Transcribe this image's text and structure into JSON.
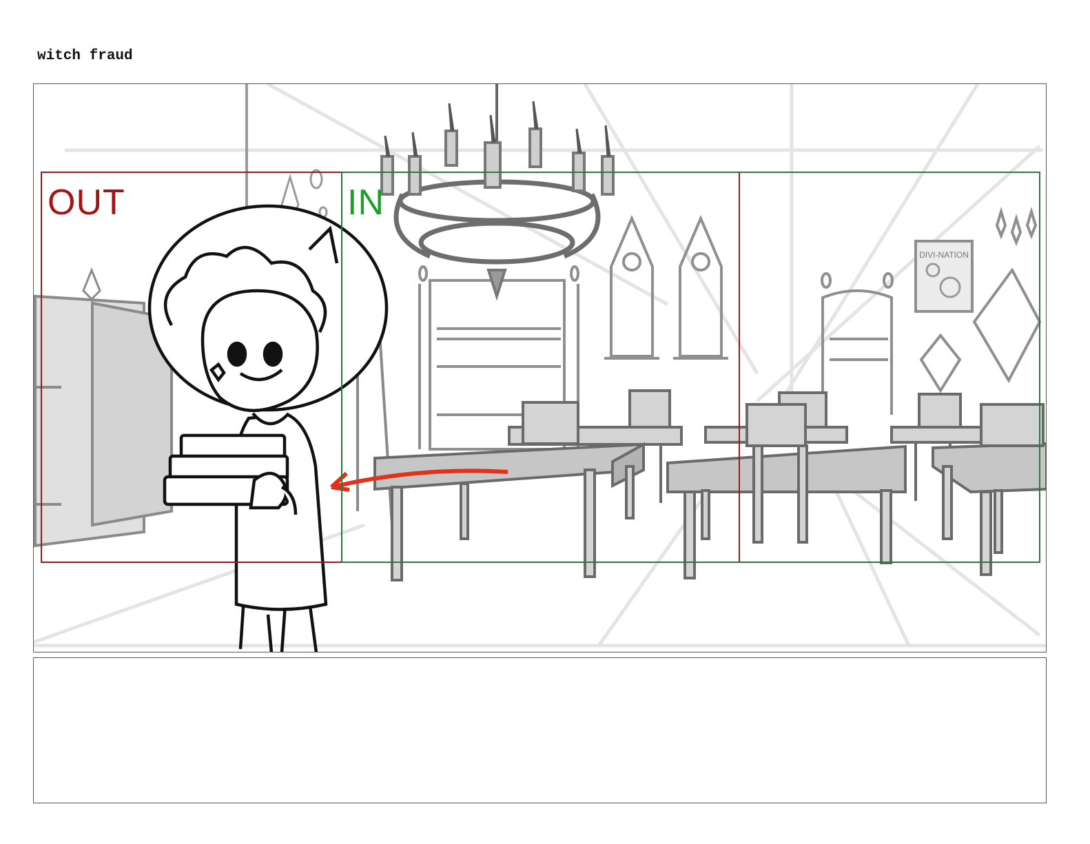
{
  "page": {
    "title": "witch fraud"
  },
  "panel": {
    "frames": {
      "out": {
        "label": "OUT",
        "color": "#a31515"
      },
      "in": {
        "label": "IN",
        "color": "#1e9e2a"
      }
    },
    "poster_text": "DIVI-NATION",
    "camera_move_color": "#e2321b"
  },
  "notes": {
    "text": ""
  }
}
